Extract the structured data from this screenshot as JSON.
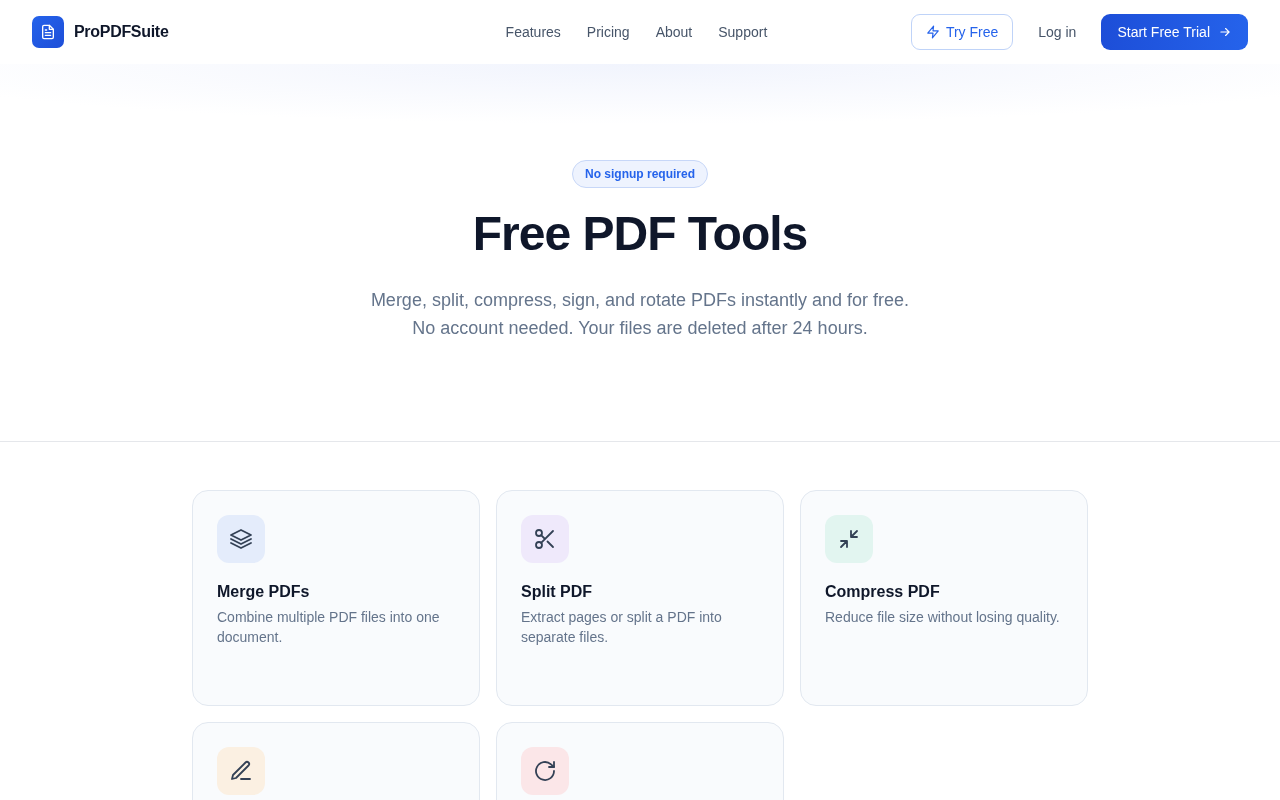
{
  "header": {
    "brand": "ProPDFSuite",
    "nav": [
      {
        "label": "Features"
      },
      {
        "label": "Pricing"
      },
      {
        "label": "About"
      },
      {
        "label": "Support"
      }
    ],
    "try_button": "Try Free",
    "login": "Log in",
    "cta": "Start Free Trial"
  },
  "hero": {
    "badge": "No signup required",
    "title": "Free PDF Tools",
    "subtitle": [
      "Merge, split, compress, sign, and rotate PDFs instantly and for free.",
      "No account needed. Your files are deleted after 24 hours."
    ]
  },
  "tools": [
    {
      "kind": "layers",
      "color": "#e4ecfb",
      "title": "Merge PDFs",
      "description": "Combine multiple PDF files into one document."
    },
    {
      "kind": "scissors",
      "color": "#efe9fb",
      "title": "Split PDF",
      "description": "Extract pages or split a PDF into separate files."
    },
    {
      "kind": "compress",
      "color": "#e2f5f0",
      "title": "Compress PDF",
      "description": "Reduce file size without losing quality."
    },
    {
      "kind": "pen",
      "color": "#fbf0e2"
    },
    {
      "kind": "rotate",
      "color": "#fbe6e8"
    }
  ]
}
